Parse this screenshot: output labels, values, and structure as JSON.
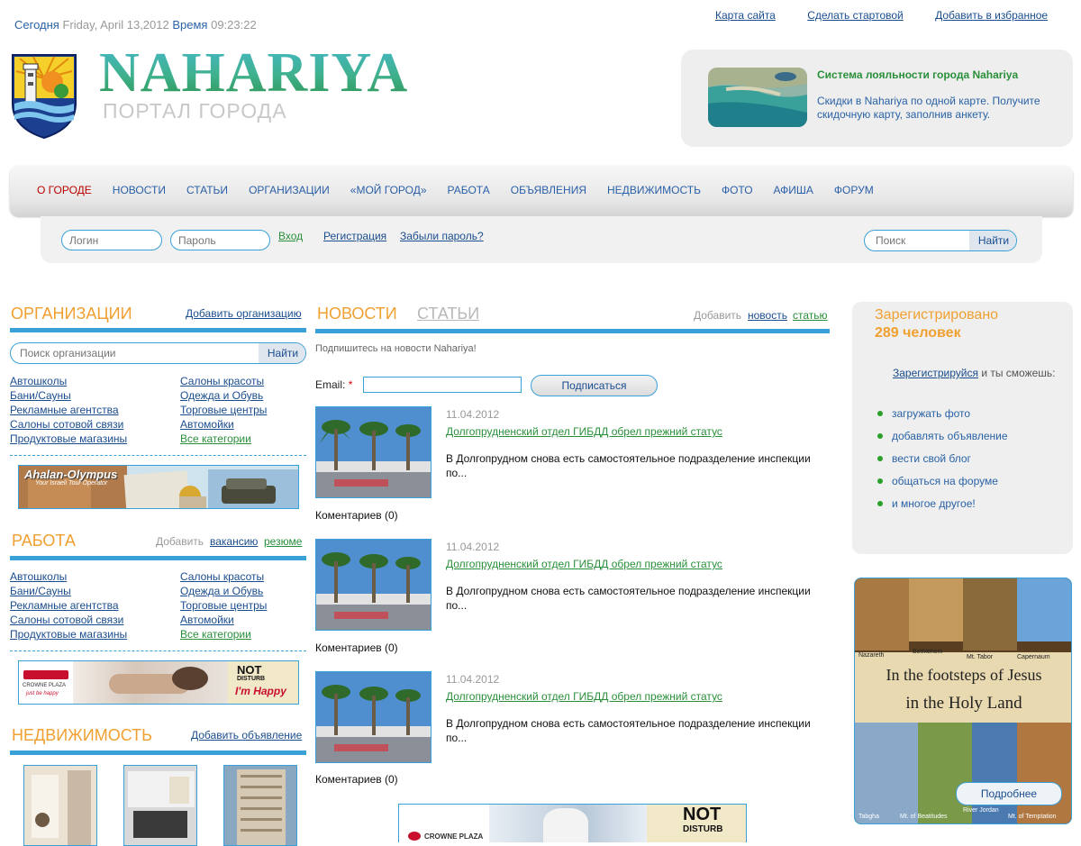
{
  "header": {
    "today_label": "Сегодня",
    "date": "Friday, April 13,2012",
    "time_label": "Время",
    "time": "09:23:22",
    "links": [
      "Карта сайта",
      "Сделать стартовой",
      "Добавить в избранное"
    ],
    "logo_title": "NAHARIYA",
    "logo_subtitle": "ПОРТАЛ ГОРОДА"
  },
  "promo": {
    "title": "Система лояльности города Nahariya",
    "text": "Скидки в Nahariya по одной карте. Получите скидочную карту, заполнив анкету."
  },
  "nav": {
    "items": [
      "О ГОРОДЕ",
      "НОВОСТИ",
      "СТАТЬИ",
      "ОРГАНИЗАЦИИ",
      "«МОЙ ГОРОД»",
      "РАБОТА",
      "ОБЪЯВЛЕНИЯ",
      "НЕДВИЖИМОСТЬ",
      "ФОТО",
      "АФИША",
      "ФОРУМ"
    ]
  },
  "login": {
    "login_placeholder": "Логин",
    "password_placeholder": "Пароль",
    "enter": "Вход",
    "register": "Регистрация",
    "forgot": "Забыли пароль?",
    "search_placeholder": "Поиск",
    "search_button": "Найти"
  },
  "orgs": {
    "title": "ОРГАНИЗАЦИИ",
    "add": "Добавить организацию",
    "search_placeholder": "Поиск организации",
    "search_button": "Найти",
    "col1": [
      "Автошколы",
      "Бани/Сауны",
      "Рекламные агентства",
      "Салоны сотовой связи",
      "Продуктовые магазины"
    ],
    "col2": [
      "Салоны красоты",
      "Одежда и Обувь",
      "Торговые центры",
      "Автомойки",
      "Все категории"
    ]
  },
  "jobs": {
    "title": "РАБОТА",
    "add_label": "Добавить",
    "add_vacancy": "вакансию",
    "add_resume": "резюме",
    "col1": [
      "Автошколы",
      "Бани/Сауны",
      "Рекламные агентства",
      "Салоны сотовой связи",
      "Продуктовые магазины"
    ],
    "col2": [
      "Салоны красоты",
      "Одежда и Обувь",
      "Торговые центры",
      "Автомойки",
      "Все категории"
    ]
  },
  "realty": {
    "title": "НЕДВИЖИМОСТЬ",
    "add": "Добавить объявление"
  },
  "banners": {
    "ahalan_title": "Ahalan-Olympus",
    "ahalan_sub": "Your Israeli Tour Operator",
    "crowne": "CROWNE PLAZA",
    "crowne_tag": "just be happy",
    "not": "NOT",
    "disturb": "DISTURB",
    "happy": "I'm Happy",
    "holy_line1": "In the footsteps of Jesus",
    "holy_line2": "in the Holy Land",
    "holy_places": [
      "Nazareth",
      "Bethlehem",
      "Mt. Tabor",
      "Capernaum",
      "Tabgha",
      "Mt. of Beatitudes",
      "River Jordan",
      "Mt. of Temptation"
    ],
    "holy_button": "Подробнее"
  },
  "news": {
    "tab_news": "НОВОСТИ",
    "tab_articles": "СТАТЬИ",
    "add_label": "Добавить",
    "add_news": "новость",
    "add_article": "статью",
    "subscribe_text": "Подпишитесь на новости Nahariya!",
    "email_label": "Email:",
    "required_mark": "*",
    "subscribe_button": "Подписаться",
    "items": [
      {
        "date": "11.04.2012",
        "title": "Долгопрудненский отдел ГИБДД обрел прежний статус",
        "text": "В Долгопрудном снова есть самостоятельное подразделение инспекции по...",
        "comments": "Коментариев (0)"
      },
      {
        "date": "11.04.2012",
        "title": "Долгопрудненский отдел ГИБДД обрел прежний статус",
        "text": "В Долгопрудном снова есть самостоятельное подразделение инспекции по...",
        "comments": "Коментариев (0)"
      },
      {
        "date": "11.04.2012",
        "title": "Долгопрудненский отдел ГИБДД обрел прежний статус",
        "text": "В Долгопрудном снова есть самостоятельное подразделение инспекции по...",
        "comments": "Коментариев (0)"
      }
    ]
  },
  "register": {
    "title": "Зарегистрировано",
    "count": "289 человек",
    "link": "Зарегистрируйся",
    "tail": "и ты сможешь:",
    "items": [
      "загружать фото",
      "добавлять объявление",
      "вести свой блог",
      "общаться на форуме",
      "и многое другое!"
    ]
  }
}
